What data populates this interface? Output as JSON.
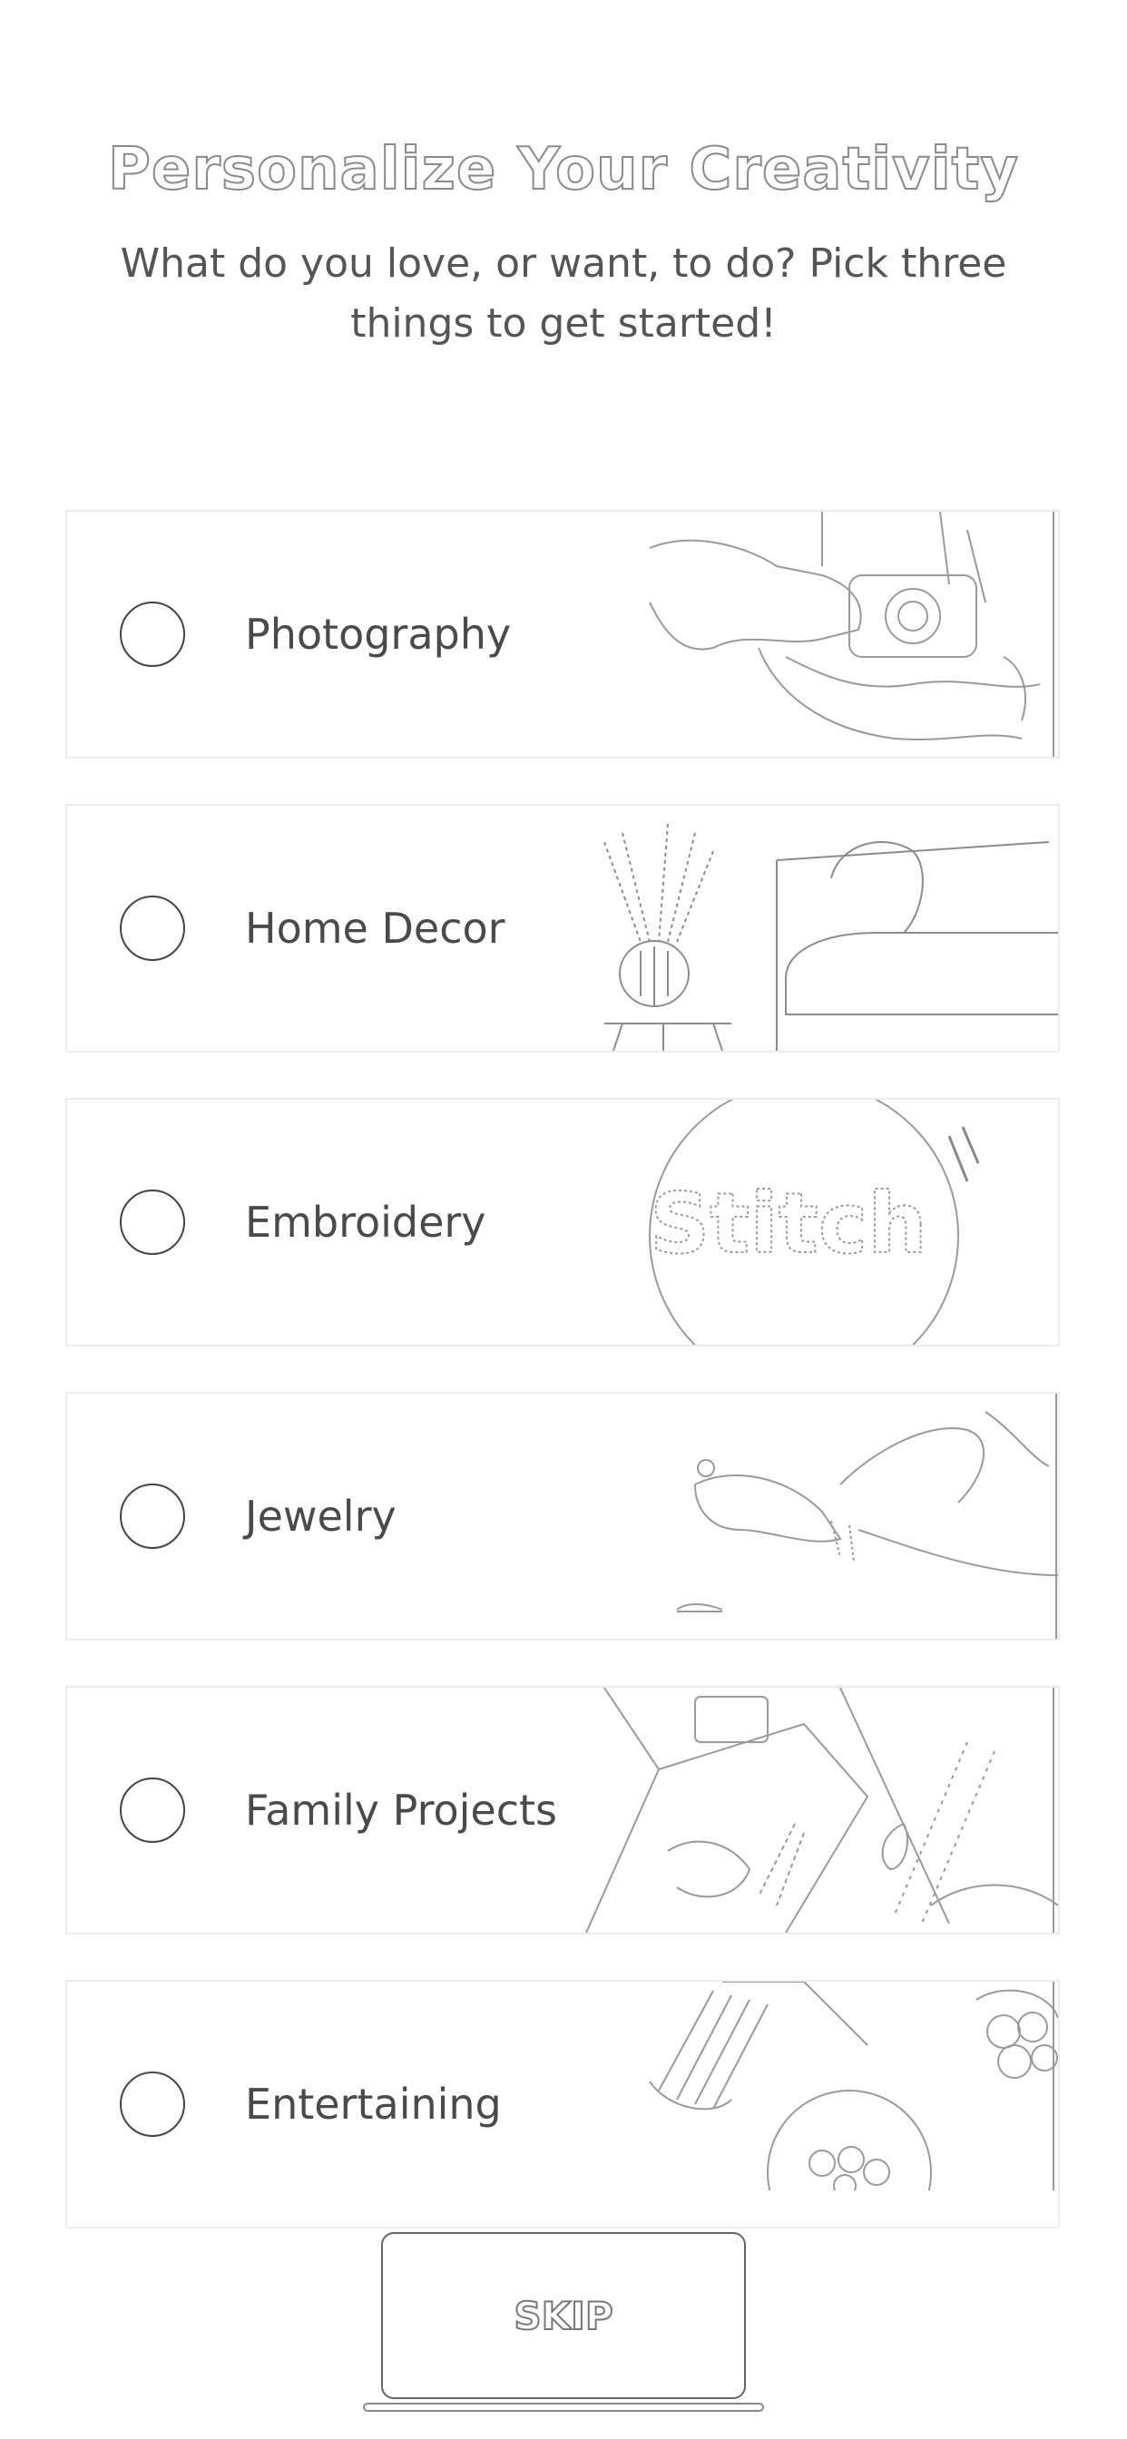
{
  "header": {
    "title": "Personalize Your Creativity",
    "subtitle": "What do you love, or want, to do? Pick three things to get started!"
  },
  "categories": [
    {
      "label": "Photography",
      "selected": false,
      "image": "camera-hands-image"
    },
    {
      "label": "Home Decor",
      "selected": false,
      "image": "vase-sofa-image"
    },
    {
      "label": "Embroidery",
      "selected": false,
      "image": "embroidery-hoop-image"
    },
    {
      "label": "Jewelry",
      "selected": false,
      "image": "jewelry-hands-image"
    },
    {
      "label": "Family Projects",
      "selected": false,
      "image": "craft-table-image"
    },
    {
      "label": "Entertaining",
      "selected": false,
      "image": "food-platter-image"
    }
  ],
  "embroidery_art_text": "Stitch",
  "footer": {
    "skip_label": "SKIP"
  }
}
